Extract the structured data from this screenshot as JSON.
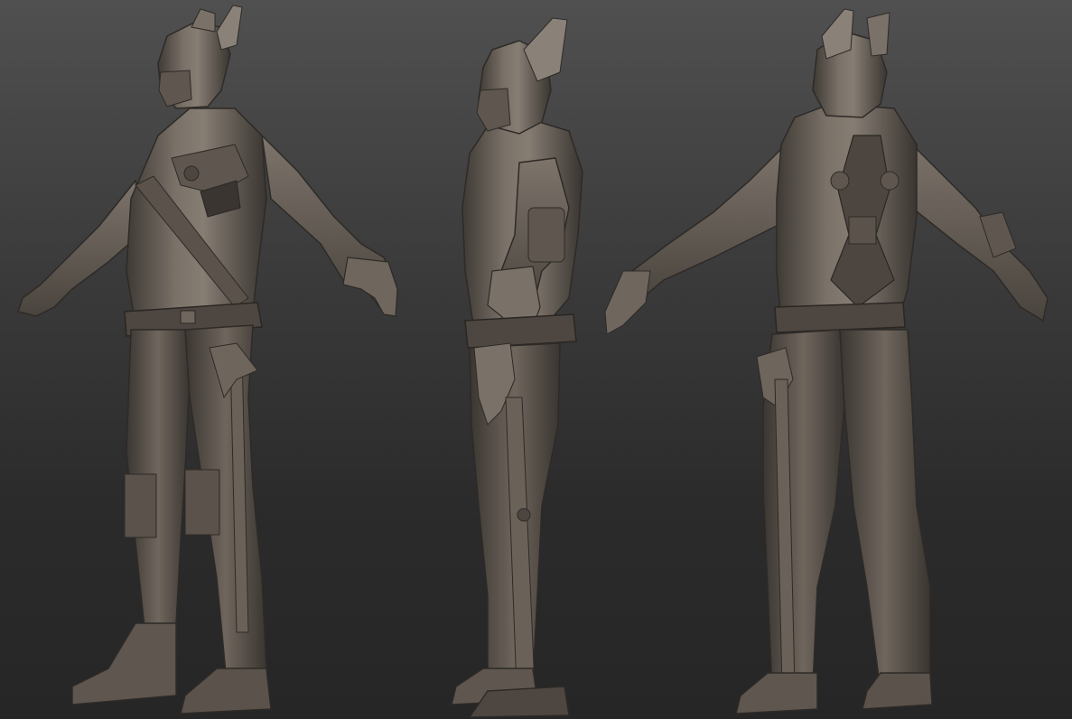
{
  "scene": {
    "description_kind": "sculpt-turnaround",
    "views": [
      {
        "id": "three-quarter-front",
        "pose": "a-pose"
      },
      {
        "id": "side",
        "pose": "a-pose"
      },
      {
        "id": "three-quarter-back",
        "pose": "a-pose"
      }
    ]
  },
  "colors": {
    "background_top": "#505050",
    "background_bottom": "#262626",
    "clay_base": "#6b6259",
    "clay_light": "#8a8178",
    "clay_shadow": "#3f3a35",
    "clay_deep": "#2e2a27"
  }
}
